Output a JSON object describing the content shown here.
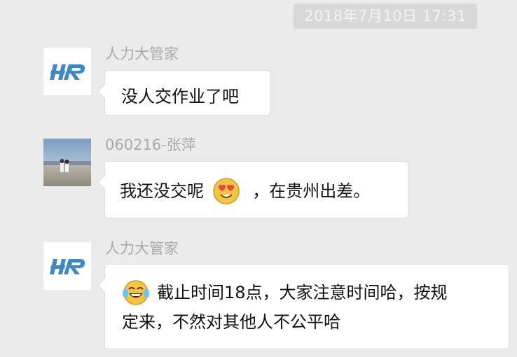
{
  "timestamp": "2018年7月10日 17:31",
  "messages": [
    {
      "sender": "人力大管家",
      "avatar_icon": "hr-logo-icon",
      "text": "没人交作业了吧"
    },
    {
      "sender": "060216-张萍",
      "avatar_icon": "beach-photo-avatar",
      "text_before": "我还没交呢",
      "emoji": "heart-eyes-emoji",
      "text_after": "，在贵州出差。"
    },
    {
      "sender": "人力大管家",
      "avatar_icon": "hr-logo-icon",
      "emoji": "tears-of-joy-emoji",
      "line1": "截止时间18点，大家注意时间哈，按规",
      "line2": "定来，不然对其他人不公平哈"
    }
  ],
  "colors": {
    "background": "#ebebeb",
    "bubble": "#ffffff",
    "hr_logo_blue": "#3d88c6",
    "sender_text": "#a9a9a9"
  }
}
